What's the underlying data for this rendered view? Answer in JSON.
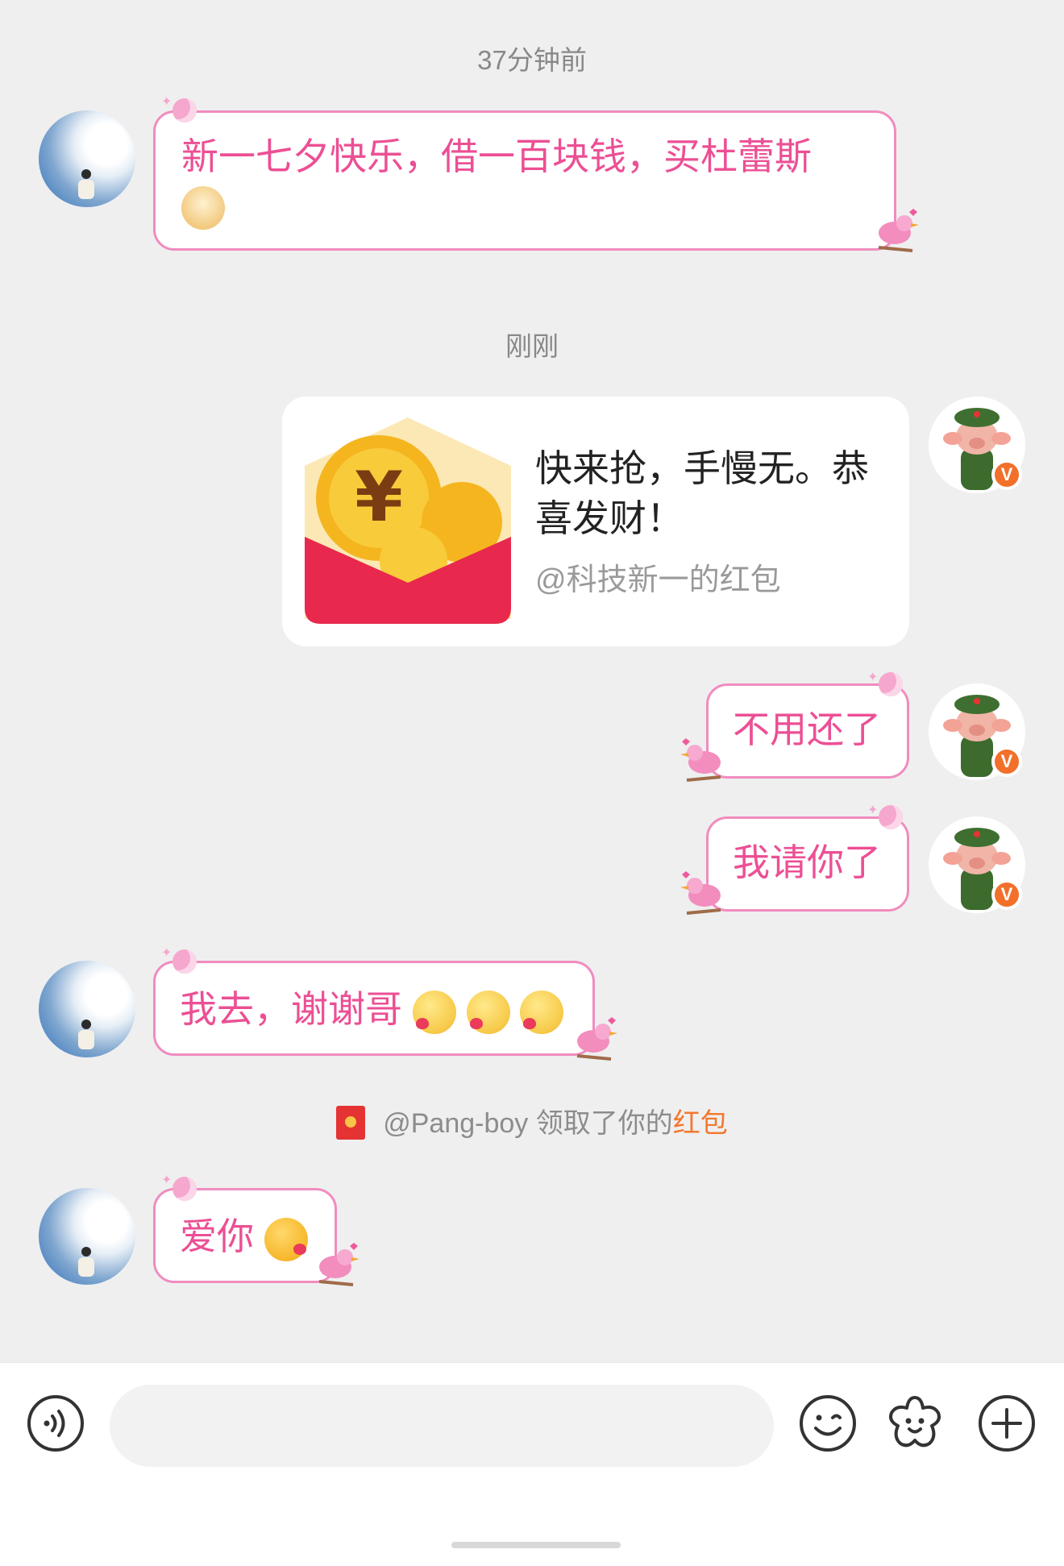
{
  "timestamps": [
    "37分钟前",
    "刚刚"
  ],
  "messages": {
    "m1": {
      "text": "新一七夕快乐，借一百块钱，买杜蕾斯",
      "emoji": "doge-emoji"
    },
    "m2": {
      "title": "快来抢，手慢无。恭喜发财！",
      "sub": "@科技新一的红包"
    },
    "m3": {
      "text": "不用还了"
    },
    "m4": {
      "text": "我请你了"
    },
    "m5": {
      "text": "我去，谢谢哥",
      "emoji": "shy-love-emoji"
    },
    "m6": {
      "text": "爱你",
      "emoji": "kiss-emoji"
    }
  },
  "claim_notice": {
    "user": "@Pang-boy",
    "action": "领取了你的",
    "highlight": "红包"
  },
  "input_bar": {
    "placeholder": ""
  },
  "icons": [
    "voice-icon",
    "emoji-icon",
    "sticker-icon",
    "plus-icon",
    "red-packet-icon",
    "verified-badge-icon"
  ],
  "colors": {
    "bubble_text": "#ec4f94",
    "bubble_border": "#f08cbf",
    "highlight": "#f4772c",
    "background": "#efeff0"
  }
}
